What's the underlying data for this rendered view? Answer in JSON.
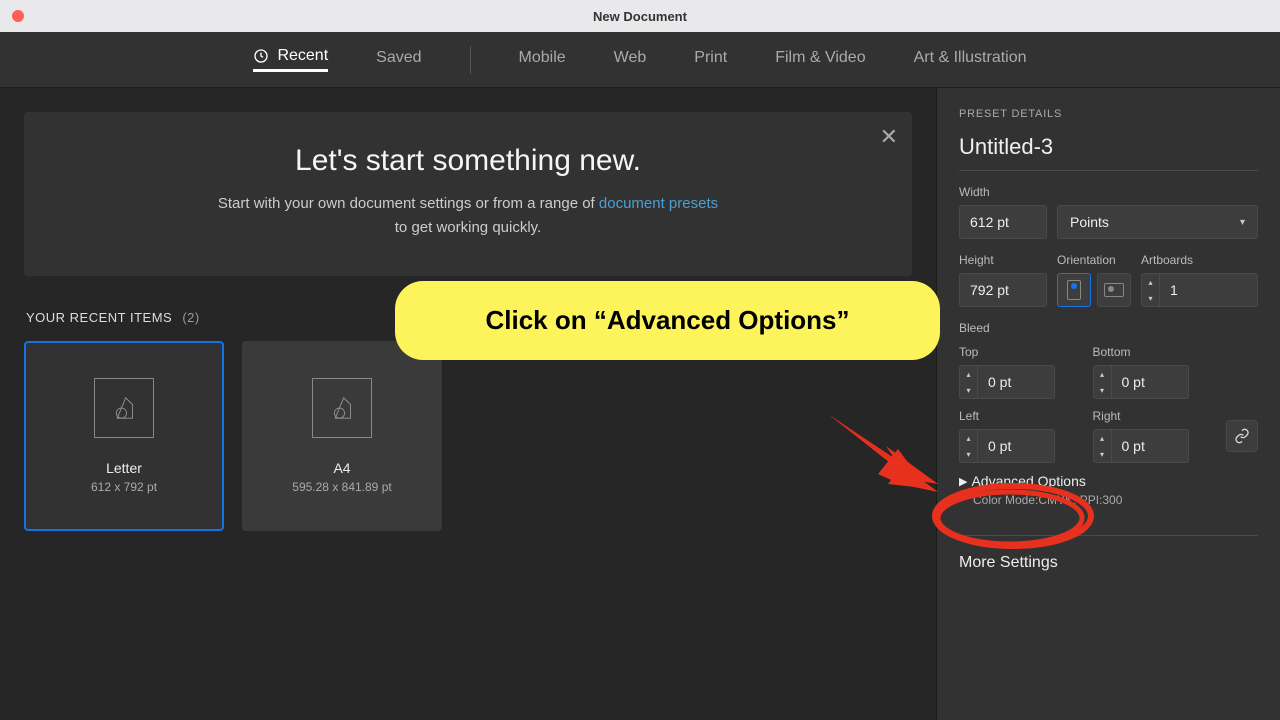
{
  "window": {
    "title": "New Document"
  },
  "tabs": {
    "recent": "Recent",
    "saved": "Saved",
    "mobile": "Mobile",
    "web": "Web",
    "print": "Print",
    "film": "Film & Video",
    "art": "Art & Illustration"
  },
  "hero": {
    "heading": "Let's start something new.",
    "line1a": "Start with your own document settings or from a range of ",
    "link": "document presets",
    "line2": "to get working quickly."
  },
  "recent_section": {
    "title": "YOUR RECENT ITEMS",
    "count": "(2)",
    "items": [
      {
        "name": "Letter",
        "dim": "612 x 792 pt"
      },
      {
        "name": "A4",
        "dim": "595.28 x 841.89 pt"
      }
    ]
  },
  "panel": {
    "header": "PRESET DETAILS",
    "doc_name": "Untitled-3",
    "labels": {
      "width": "Width",
      "height": "Height",
      "orientation": "Orientation",
      "artboards": "Artboards",
      "bleed": "Bleed",
      "top": "Top",
      "bottom": "Bottom",
      "left": "Left",
      "right": "Right"
    },
    "width_value": "612 pt",
    "units": "Points",
    "height_value": "792 pt",
    "artboards_value": "1",
    "bleed": {
      "top": "0 pt",
      "bottom": "0 pt",
      "left": "0 pt",
      "right": "0 pt"
    },
    "advanced": "Advanced Options",
    "advanced_sub": "Color Mode:CMYK, PPI:300",
    "more": "More Settings"
  },
  "annotation": {
    "callout": "Click on “Advanced Options”"
  }
}
